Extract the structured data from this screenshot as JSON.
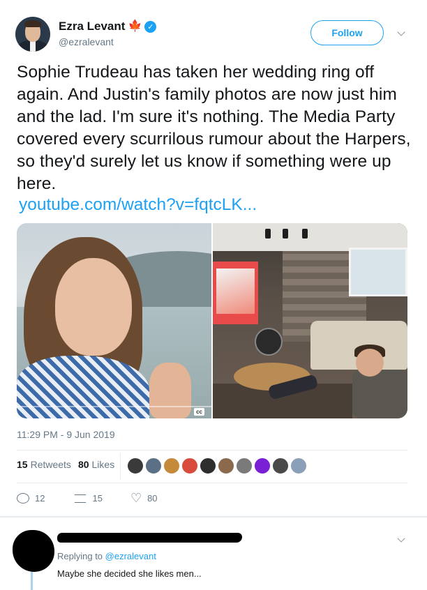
{
  "author": {
    "display_name": "Ezra Levant",
    "handle": "@ezralevant",
    "flag_icon": "maple-leaf-icon",
    "verified_icon": "verified-badge-icon"
  },
  "follow_label": "Follow",
  "tweet": {
    "text": "Sophie Trudeau has taken her wedding ring off again. And Justin's family photos are now just him and the lad. I'm sure it's nothing. The Media Party covered every scurrilous rumour about the Harpers, so they'd surely let us know if something were up here.",
    "link": "youtube.com/watch?v=fqtcLK...",
    "media": {
      "left_badge": "cc"
    },
    "timestamp": "11:29 PM - 9 Jun 2019"
  },
  "stats": {
    "retweets_count": "15",
    "retweets_label": "Retweets",
    "likes_count": "80",
    "likes_label": "Likes"
  },
  "actions": {
    "reply_count": "12",
    "retweet_count": "15",
    "like_count": "80"
  },
  "reply": {
    "replying_to_prefix": "Replying to",
    "replying_to_handle": "@ezralevant",
    "text": "Maybe she decided she likes men..."
  },
  "colors": {
    "accent": "#1da1f2",
    "text": "#14171a",
    "muted": "#657786",
    "maple": "#d52b1e"
  }
}
